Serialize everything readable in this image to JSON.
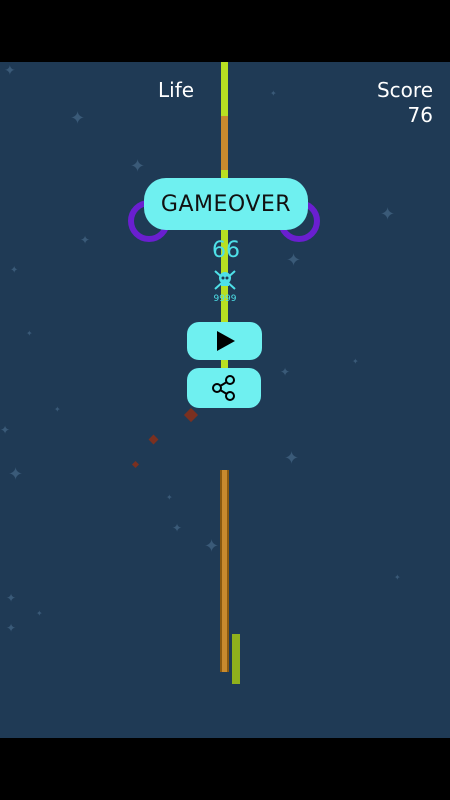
{
  "hud": {
    "life_label": "Life",
    "score_label": "Score",
    "score_value": "76"
  },
  "dialog": {
    "title": "GAMEOVER",
    "current_score": "66",
    "best_score": "9999",
    "badge_icon": "skull-crossbones-icon"
  },
  "buttons": {
    "play_icon": "play-icon",
    "share_icon": "share-icon"
  },
  "colors": {
    "background": "#1f3a55",
    "button": "#6ff0f0",
    "ring": "#6a1fd0",
    "pole_green": "#b8e022",
    "pole_orange": "#c88a2e",
    "text_accent": "#4ee0e8"
  }
}
